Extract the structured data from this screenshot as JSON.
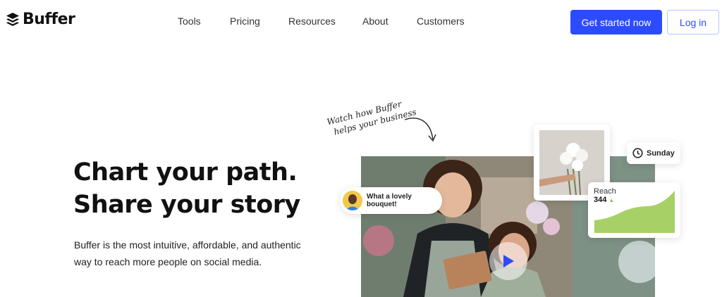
{
  "brand": {
    "name": "Buffer"
  },
  "nav": {
    "links": [
      "Tools",
      "Pricing",
      "Resources",
      "About",
      "Customers"
    ],
    "cta_primary": "Get started now",
    "cta_secondary": "Log in"
  },
  "hero": {
    "headline_line1": "Chart your path.",
    "headline_line2": "Share your story",
    "subtext": "Buffer is the most intuitive, affordable, and authentic way to reach more people on social media.",
    "handwritten_line1": "Watch how Buffer",
    "handwritten_line2": "helps your business"
  },
  "cards": {
    "comment": "What a lovely bouquet!",
    "day": "Sunday",
    "reach_label": "Reach",
    "reach_value": "344"
  },
  "colors": {
    "accent": "#2c4bff",
    "reach_fill": "#a7d166"
  },
  "icons": {
    "logo": "buffer-stack-icon",
    "clock": "clock-icon",
    "play": "play-icon",
    "trend": "up-triangle-icon"
  }
}
